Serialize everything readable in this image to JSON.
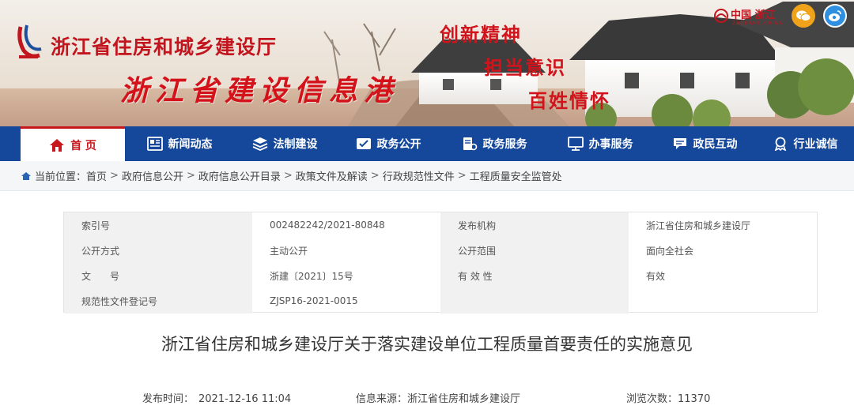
{
  "header": {
    "site_title": "浙江省住房和城乡建设厅",
    "brand_title": "浙江省建设信息港",
    "slogans": [
      "创新精神",
      "担当意识",
      "百姓情怀"
    ],
    "gov_logo_text": "中国 浙江",
    "gov_logo_sub": "ZHEJIANG.CHINA"
  },
  "nav": {
    "items": [
      {
        "label": "首 页",
        "icon": "home-icon"
      },
      {
        "label": "新闻动态",
        "icon": "news-icon"
      },
      {
        "label": "法制建设",
        "icon": "layers-icon"
      },
      {
        "label": "政务公开",
        "icon": "public-icon"
      },
      {
        "label": "政务服务",
        "icon": "service-icon"
      },
      {
        "label": "办事服务",
        "icon": "monitor-icon"
      },
      {
        "label": "政民互动",
        "icon": "chat-icon"
      },
      {
        "label": "行业诚信",
        "icon": "badge-icon"
      }
    ]
  },
  "breadcrumb": {
    "label": "当前位置：",
    "items": [
      "首页",
      "政府信息公开",
      "政府信息公开目录",
      "政策文件及解读",
      "行政规范性文件",
      "工程质量安全监管处"
    ]
  },
  "info": {
    "rows": [
      [
        "索引号",
        "002482242/2021-80848",
        "发布机构",
        "浙江省住房和城乡建设厅"
      ],
      [
        "公开方式",
        "主动公开",
        "公开范围",
        "面向全社会"
      ],
      [
        "文　　号",
        "浙建〔2021〕15号",
        "有 效 性",
        "有效"
      ],
      [
        "规范性文件登记号",
        "ZJSP16-2021-0015",
        "",
        ""
      ]
    ]
  },
  "article": {
    "title": "浙江省住房和城乡建设厅关于落实建设单位工程质量首要责任的实施意见",
    "publish_time_label": "发布时间：",
    "publish_time": "2021-12-16 11:04",
    "source_label": "信息来源：",
    "source": "浙江省住房和城乡建设厅",
    "views_label": "浏览次数：",
    "views": "11370"
  },
  "colors": {
    "nav_bg": "#15489a",
    "brand_red": "#c8161d",
    "breadcrumb_bg": "#f4f6f8",
    "label_cell_bg": "#f1f1f1"
  }
}
